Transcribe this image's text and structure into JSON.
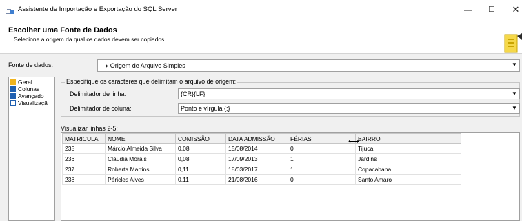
{
  "window": {
    "title": "Assistente de Importação e Exportação do SQL Server",
    "minimize": "—",
    "maximize": "☐",
    "close": "✕"
  },
  "header": {
    "title": "Escolher uma Fonte de Dados",
    "subtitle": "Selecione a origem da qual os dados devem ser copiados."
  },
  "source": {
    "label": "Fonte de dados:",
    "value": "Origem de Arquivo Simples",
    "icon": "flat-file-source-icon"
  },
  "nav": {
    "items": [
      {
        "label": "Geral",
        "icon": "general-page-icon",
        "color": "#f0b41e"
      },
      {
        "label": "Colunas",
        "icon": "columns-page-icon",
        "color": "#1f5fb0"
      },
      {
        "label": "Avançado",
        "icon": "advanced-page-icon",
        "color": "#1f5fb0"
      },
      {
        "label": "Visualizaçã",
        "icon": "preview-page-icon",
        "color": "#ffffff"
      }
    ]
  },
  "delimiters": {
    "legend": "Especifique os caracteres que delimitam o arquivo de origem:",
    "row_label": "Delimitador de linha:",
    "row_value": "{CR}{LF}",
    "col_label": "Delimitador de coluna:",
    "col_value": "Ponto e vírgula {;}"
  },
  "preview": {
    "label": "Visualizar linhas 2-5:",
    "columns": [
      "MATRICULA",
      "NOME",
      "COMISSÃO",
      "DATA ADMISSÃO",
      "FÉRIAS",
      "BAIRRO"
    ],
    "rows": [
      [
        "235",
        "Márcio Almeida Silva",
        "0,08",
        "15/08/2014",
        "0",
        "Tijuca"
      ],
      [
        "236",
        "Cláudia Morais",
        "0,08",
        "17/09/2013",
        "1",
        "Jardins"
      ],
      [
        "237",
        "Roberta Martins",
        "0,11",
        "18/03/2017",
        "1",
        "Copacabana"
      ],
      [
        "238",
        "Péricles Alves",
        "0,11",
        "21/08/2016",
        "0",
        "Santo Amaro"
      ]
    ]
  }
}
